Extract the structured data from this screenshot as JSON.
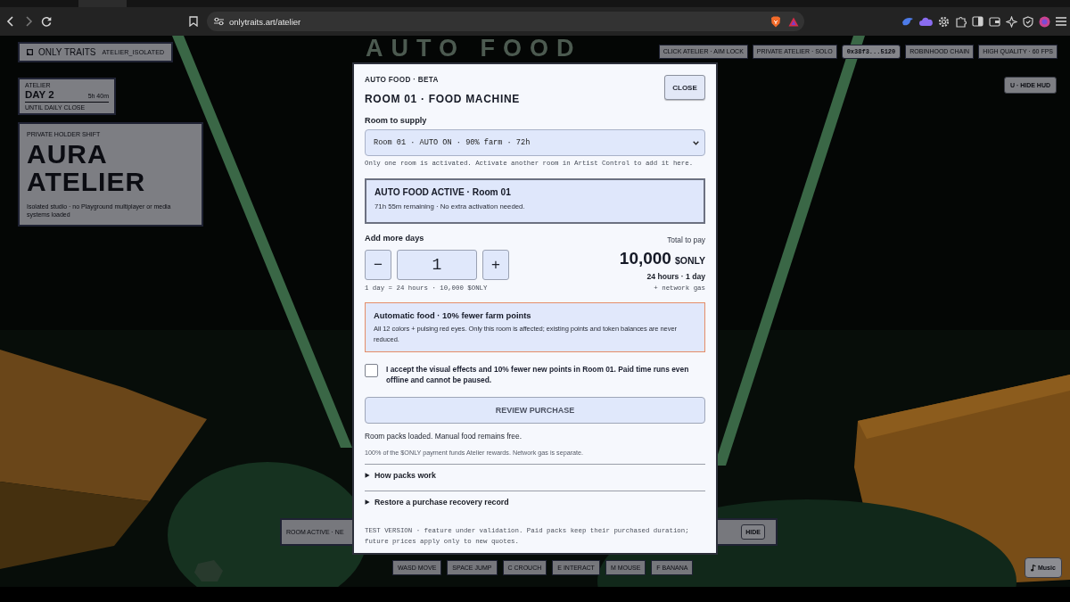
{
  "browser": {
    "url": "onlytraits.art/atelier"
  },
  "scene": {
    "sign": "AUTO FOOD"
  },
  "hud": {
    "brand": {
      "title": "ONLY TRAITS",
      "tag": "ATELIER_ISOLATED"
    },
    "day": {
      "label": "ATELIER",
      "title": "DAY 2",
      "time": "5h 40m",
      "caption": "UNTIL DAILY CLOSE"
    },
    "shift": {
      "label": "PRIVATE HOLDER SHIFT",
      "title": "AURA ATELIER",
      "caption": "Isolated studio · no Playground multiplayer or media systems loaded"
    },
    "status_pills": [
      {
        "text": "CLICK ATELIER · AIM LOCK",
        "kind": "plain"
      },
      {
        "text": "PRIVATE ATELIER · SOLO",
        "kind": "plain"
      },
      {
        "text": "0x38f3...5120",
        "kind": "wallet"
      },
      {
        "text": "ROBINHOOD CHAIN",
        "kind": "plain"
      },
      {
        "text": "HIGH QUALITY · 60 FPS",
        "kind": "plain"
      }
    ],
    "hide_hud_button": "U · HIDE HUD",
    "room_bar": {
      "text": "ROOM ACTIVE · NE",
      "hide_button": "HIDE"
    },
    "keys": [
      "WASD MOVE",
      "SPACE JUMP",
      "C CROUCH",
      "E INTERACT",
      "M MOUSE",
      "F BANANA"
    ],
    "music_button": "Music"
  },
  "modal": {
    "eyebrow": "AUTO FOOD · BETA",
    "title": "ROOM 01 · FOOD MACHINE",
    "close_button": "CLOSE",
    "room_select": {
      "label": "Room to supply",
      "value": "Room 01 · AUTO ON · 90% farm · 72h",
      "hint": "Only one room is activated. Activate another room in Artist Control to add it here."
    },
    "status_box": {
      "title": "AUTO FOOD ACTIVE · Room 01",
      "text": "71h 55m remaining · No extra activation needed."
    },
    "days": {
      "label": "Add more days",
      "decrement": "−",
      "value": "1",
      "increment": "+",
      "note": "1 day = 24 hours · 10,000 $ONLY"
    },
    "total": {
      "label": "Total to pay",
      "amount": "10,000",
      "currency": "$ONLY",
      "duration": "24 hours · 1 day",
      "gas": "+ network gas"
    },
    "warning": {
      "title": "Automatic food · 10% fewer farm points",
      "text": "All 12 colors + pulsing red eyes. Only this room is affected; existing points and token balances are never reduced."
    },
    "consent": {
      "checked": false,
      "text": "I accept the visual effects and 10% fewer new points in Room 01. Paid time runs even offline and cannot be paused."
    },
    "review_button": {
      "label": "REVIEW PURCHASE",
      "disabled": true
    },
    "status_text": "Room packs loaded. Manual food remains free.",
    "funding_note": "100% of the $ONLY payment funds Atelier rewards. Network gas is separate.",
    "sections": [
      {
        "title": "How packs work",
        "expanded": false
      },
      {
        "title": "Restore a purchase recovery record",
        "expanded": false
      }
    ],
    "footnote": "TEST VERSION · feature under validation. Paid packs keep their purchased duration; future prices apply only to new quotes."
  }
}
